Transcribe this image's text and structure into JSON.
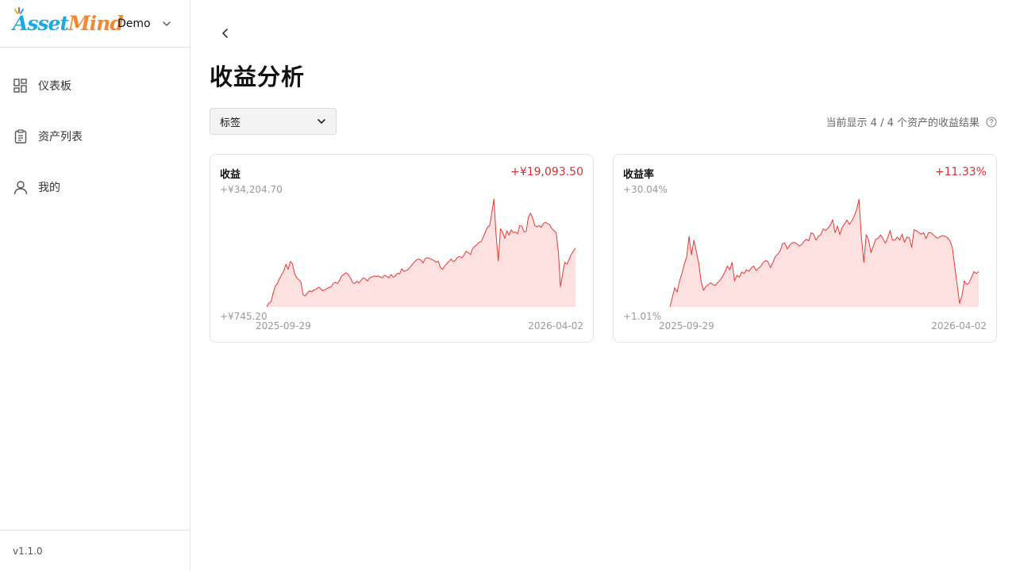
{
  "app": {
    "logo_text": {
      "part1": "Asset",
      "part2": "Mind"
    },
    "workspace": "Demo",
    "version": "v1.1.0"
  },
  "sidebar": {
    "items": [
      {
        "label": "仪表板",
        "icon": "dashboard-grid-icon"
      },
      {
        "label": "资产列表",
        "icon": "clipboard-icon"
      },
      {
        "label": "我的",
        "icon": "user-icon"
      }
    ]
  },
  "page": {
    "title": "收益分析",
    "filter": {
      "value": "标签"
    },
    "summary": "当前显示 4 / 4 个资产的收益结果"
  },
  "colors": {
    "accent_red": "#d32f2f",
    "line_red": "#e53935",
    "area_fill": "#fde0e0"
  },
  "cards": [
    {
      "title": "收益",
      "value": "+¥19,093.50",
      "max_label": "+¥34,204.70",
      "min_label": "+¥745.20",
      "start_date": "2025-09-29",
      "end_date": "2026-04-02"
    },
    {
      "title": "收益率",
      "value": "+11.33%",
      "max_label": "+30.04%",
      "min_label": "+1.01%",
      "start_date": "2025-09-29",
      "end_date": "2026-04-02"
    }
  ],
  "chart_data": [
    {
      "type": "area",
      "title": "收益",
      "x_range": [
        "2025-09-29",
        "2026-04-02"
      ],
      "ylim": [
        745.2,
        34204.7
      ],
      "grid": false,
      "values": [
        745,
        2000,
        2300,
        5000,
        7200,
        8000,
        9600,
        10800,
        12000,
        14000,
        12400,
        14800,
        14200,
        11200,
        9800,
        9200,
        8400,
        4500,
        4200,
        5000,
        5800,
        5400,
        6000,
        6200,
        6800,
        6600,
        5800,
        6000,
        6400,
        6800,
        7000,
        8000,
        8400,
        8000,
        9000,
        10400,
        10800,
        11400,
        10800,
        9800,
        8400,
        8000,
        8700,
        8200,
        9000,
        9800,
        9400,
        8800,
        9800,
        10000,
        10400,
        10200,
        10400,
        10000,
        9800,
        10600,
        10200,
        9800,
        10800,
        10000,
        10400,
        11200,
        11000,
        12600,
        11800,
        12000,
        12400,
        13200,
        14000,
        14800,
        15400,
        15600,
        15200,
        14400,
        15800,
        16000,
        15800,
        15400,
        15200,
        14600,
        15000,
        13000,
        12400,
        13400,
        14200,
        14800,
        15600,
        14800,
        15200,
        16200,
        16400,
        16000,
        16800,
        18000,
        17600,
        17000,
        18800,
        19600,
        20000,
        20800,
        21000,
        22400,
        24000,
        25600,
        26000,
        30000,
        34205,
        23000,
        15000,
        25000,
        24000,
        22000,
        24400,
        23000,
        24600,
        23800,
        24000,
        23400,
        26000,
        25800,
        24000,
        24200,
        28600,
        29800,
        28400,
        26000,
        25600,
        26000,
        25400,
        26600,
        27000,
        26600,
        26200,
        25000,
        24400,
        23800,
        18000,
        7000,
        11000,
        14600,
        14000,
        15400,
        17000,
        18000,
        19000
      ]
    },
    {
      "type": "area",
      "title": "收益率",
      "x_range": [
        "2025-09-29",
        "2026-04-02"
      ],
      "ylim": [
        1.01,
        30.04
      ],
      "grid": false,
      "values": [
        1.0,
        3.5,
        6.2,
        5.0,
        8.0,
        10.0,
        12.5,
        14.5,
        20.0,
        15.0,
        19.0,
        16.0,
        13.0,
        8.0,
        5.5,
        6.5,
        7.0,
        7.5,
        7.0,
        6.8,
        7.6,
        8.2,
        9.2,
        10.5,
        12.0,
        11.0,
        13.0,
        8.0,
        9.5,
        9.0,
        10.4,
        10.0,
        11.0,
        10.6,
        11.5,
        12.0,
        10.8,
        11.4,
        12.0,
        13.0,
        13.5,
        13.2,
        11.6,
        13.0,
        14.5,
        15.2,
        16.0,
        18.0,
        18.2,
        16.6,
        17.6,
        18.2,
        18.4,
        18.0,
        17.4,
        17.8,
        18.6,
        19.2,
        18.8,
        21.0,
        20.6,
        19.0,
        20.0,
        20.4,
        22.0,
        21.6,
        22.2,
        23.0,
        24.5,
        21.0,
        22.8,
        20.5,
        22.4,
        23.4,
        24.4,
        23.2,
        24.2,
        25.5,
        27.2,
        30.0,
        20.0,
        13.0,
        20.5,
        19.0,
        15.6,
        17.4,
        19.2,
        19.5,
        20.4,
        19.4,
        18.2,
        19.6,
        21.6,
        19.0,
        19.0,
        19.8,
        19.0,
        20.6,
        18.4,
        19.8,
        19.6,
        17.0,
        21.8,
        21.5,
        21.0,
        20.6,
        21.0,
        19.4,
        21.0,
        21.0,
        20.5,
        19.8,
        19.5,
        20.0,
        20.2,
        20.0,
        19.6,
        18.8,
        17.0,
        12.0,
        7.0,
        2.0,
        4.0,
        8.0,
        7.0,
        7.5,
        9.0,
        10.5,
        10.0,
        10.5
      ]
    }
  ]
}
